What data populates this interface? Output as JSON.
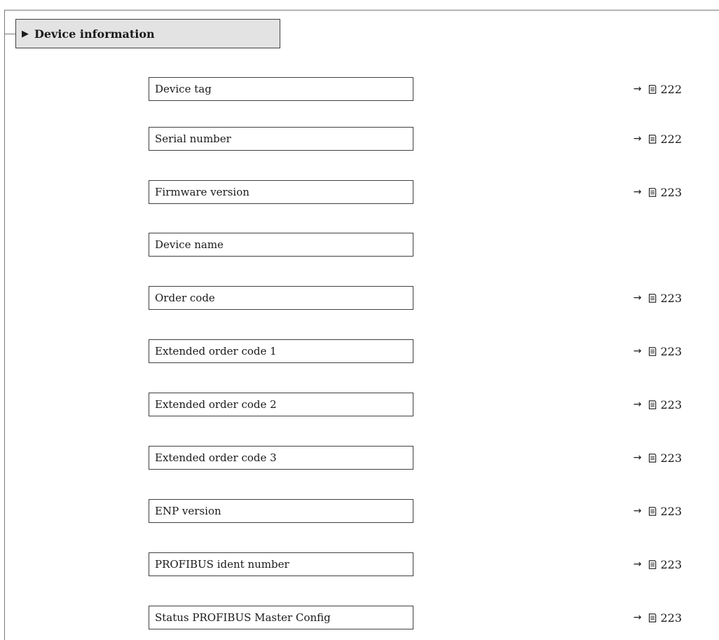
{
  "section": {
    "title": "Device information",
    "expand_icon": "triangle-right-icon"
  },
  "parameters": [
    {
      "label": "Device tag",
      "ref_arrow": "→",
      "ref_page": "222"
    },
    {
      "label": "Serial number",
      "ref_arrow": "→",
      "ref_page": "222"
    },
    {
      "label": "Firmware version",
      "ref_arrow": "→",
      "ref_page": "223"
    },
    {
      "label": "Device name",
      "ref_arrow": "",
      "ref_page": ""
    },
    {
      "label": "Order code",
      "ref_arrow": "→",
      "ref_page": "223"
    },
    {
      "label": "Extended order code 1",
      "ref_arrow": "→",
      "ref_page": "223"
    },
    {
      "label": "Extended order code 2",
      "ref_arrow": "→",
      "ref_page": "223"
    },
    {
      "label": "Extended order code 3",
      "ref_arrow": "→",
      "ref_page": "223"
    },
    {
      "label": "ENP version",
      "ref_arrow": "→",
      "ref_page": "223"
    },
    {
      "label": "PROFIBUS ident number",
      "ref_arrow": "→",
      "ref_page": "223"
    },
    {
      "label": "Status PROFIBUS Master Config",
      "ref_arrow": "→",
      "ref_page": "223"
    }
  ],
  "icons": {
    "reference": "arrow-right-icon",
    "page": "book-page-icon"
  }
}
